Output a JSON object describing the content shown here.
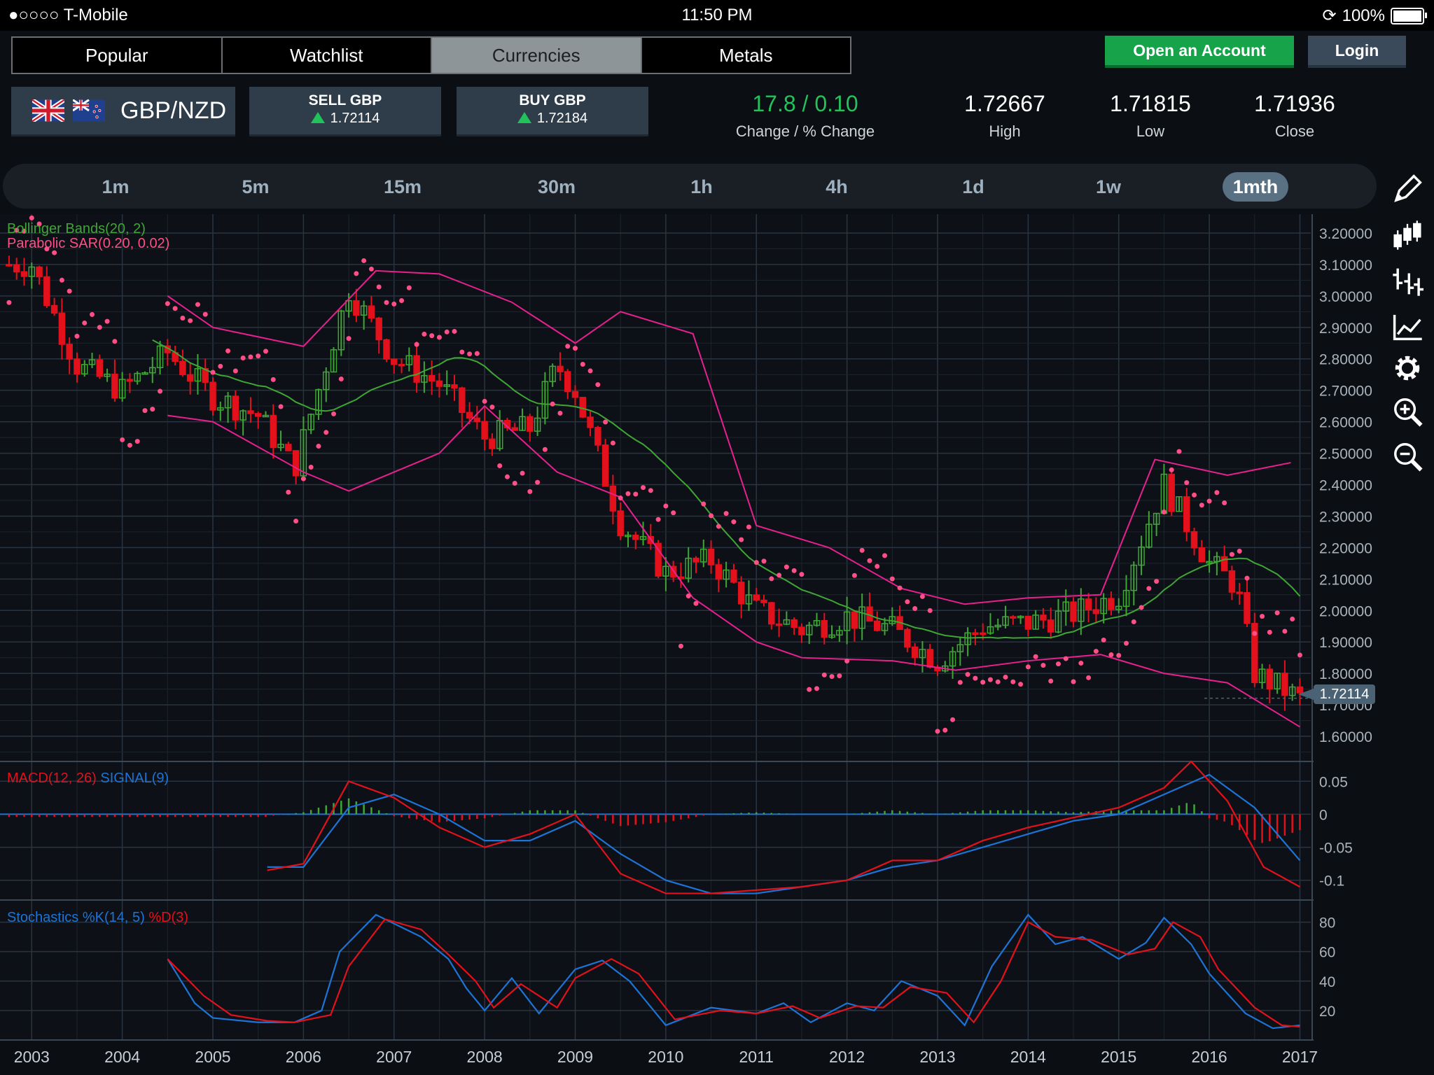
{
  "status_bar": {
    "carrier": "●○○○○ T-Mobile",
    "time": "11:50 PM",
    "battery": "100%",
    "battery_level": 1.0
  },
  "nav_tabs": [
    {
      "label": "Popular",
      "active": false
    },
    {
      "label": "Watchlist",
      "active": false
    },
    {
      "label": "Currencies",
      "active": true
    },
    {
      "label": "Metals",
      "active": false
    }
  ],
  "header_buttons": {
    "open_account": "Open an Account",
    "login": "Login"
  },
  "instrument": {
    "pair": "GBP/NZD",
    "sell_label": "SELL GBP",
    "sell_price": "1.72114",
    "buy_label": "BUY GBP",
    "buy_price": "1.72184",
    "change_value": "17.8 / 0.10",
    "change_label": "Change / % Change",
    "high_value": "1.72667",
    "high_label": "High",
    "low_value": "1.71815",
    "low_label": "Low",
    "close_value": "1.71936",
    "close_label": "Close"
  },
  "timeframes": [
    {
      "label": "1m",
      "active": false
    },
    {
      "label": "5m",
      "active": false
    },
    {
      "label": "15m",
      "active": false
    },
    {
      "label": "30m",
      "active": false
    },
    {
      "label": "1h",
      "active": false
    },
    {
      "label": "4h",
      "active": false
    },
    {
      "label": "1d",
      "active": false
    },
    {
      "label": "1w",
      "active": false
    },
    {
      "label": "1mth",
      "active": true
    }
  ],
  "toolbar_icons": [
    "pencil-icon",
    "candlestick-icon",
    "ohlc-bars-icon",
    "line-chart-icon",
    "gear-icon",
    "zoom-in-icon",
    "zoom-out-icon"
  ],
  "colors": {
    "bull": "#3fa535",
    "bear": "#e3111b",
    "sar": "#ff4f86",
    "bollinger_mid": "#3fa535",
    "bollinger_band": "#e8208f",
    "macd": "#e3111b",
    "signal": "#1d74d6",
    "stoch_k": "#1d74d6",
    "stoch_d": "#e3111b"
  },
  "current_price_tag": "1.72114",
  "chart_data": [
    {
      "type": "candlestick",
      "indicators_legend": [
        "Bollinger Bands(20, 2)",
        "Parabolic SAR(0.20, 0.02)"
      ],
      "y_ticks": [
        "3.20000",
        "3.10000",
        "3.00000",
        "2.90000",
        "2.80000",
        "2.70000",
        "2.60000",
        "2.50000",
        "2.40000",
        "2.30000",
        "2.20000",
        "2.10000",
        "2.00000",
        "1.90000",
        "1.80000",
        "1.70000",
        "1.60000"
      ],
      "ylim": [
        1.52,
        3.26
      ],
      "x_ticks": [
        "2003",
        "2004",
        "2005",
        "2006",
        "2007",
        "2008",
        "2009",
        "2010",
        "2011",
        "2012",
        "2013",
        "2014",
        "2015",
        "2016",
        "2017"
      ],
      "xlim": [
        2002.65,
        2017.12
      ],
      "series": [
        {
          "name": "Price (monthly close)",
          "x": [
            2003.0,
            2003.5,
            2004.0,
            2004.5,
            2005.0,
            2005.5,
            2005.9,
            2006.5,
            2007.0,
            2007.5,
            2008.0,
            2008.5,
            2008.8,
            2009.0,
            2009.5,
            2010.0,
            2010.5,
            2011.0,
            2011.5,
            2012.0,
            2012.5,
            2013.0,
            2013.5,
            2014.0,
            2014.5,
            2015.0,
            2015.5,
            2015.8,
            2016.0,
            2016.3,
            2016.5,
            2017.0
          ],
          "values": [
            3.1,
            2.78,
            2.7,
            2.82,
            2.68,
            2.62,
            2.45,
            3.02,
            2.8,
            2.72,
            2.55,
            2.58,
            2.78,
            2.7,
            2.28,
            2.12,
            2.16,
            2.0,
            1.94,
            1.98,
            1.94,
            1.84,
            1.95,
            1.96,
            1.99,
            2.05,
            2.4,
            2.25,
            2.15,
            2.08,
            1.8,
            1.72
          ]
        },
        {
          "name": "Bollinger upper",
          "x": [
            2004.5,
            2005.0,
            2006.0,
            2006.8,
            2007.5,
            2008.3,
            2009.0,
            2009.5,
            2010.3,
            2011.0,
            2011.8,
            2012.6,
            2013.3,
            2014.0,
            2014.8,
            2015.4,
            2016.2,
            2016.9
          ],
          "values": [
            3.0,
            2.9,
            2.84,
            3.08,
            3.07,
            2.98,
            2.85,
            2.95,
            2.88,
            2.27,
            2.2,
            2.07,
            2.02,
            2.04,
            2.05,
            2.48,
            2.43,
            2.47
          ]
        },
        {
          "name": "Bollinger lower",
          "x": [
            2004.5,
            2005.0,
            2006.0,
            2006.5,
            2007.5,
            2008.0,
            2008.8,
            2009.5,
            2010.3,
            2011.0,
            2011.5,
            2012.5,
            2013.2,
            2014.0,
            2014.8,
            2015.5,
            2016.2,
            2017.0
          ],
          "values": [
            2.62,
            2.6,
            2.44,
            2.38,
            2.5,
            2.65,
            2.44,
            2.36,
            2.04,
            1.9,
            1.85,
            1.84,
            1.81,
            1.84,
            1.86,
            1.8,
            1.77,
            1.63
          ]
        }
      ]
    },
    {
      "type": "line",
      "legend": [
        "MACD(12, 26)",
        "SIGNAL(9)"
      ],
      "y_ticks": [
        "0.05",
        "0",
        "-0.05",
        "-0.1"
      ],
      "ylim": [
        -0.13,
        0.08
      ],
      "series": [
        {
          "name": "MACD(12, 26)",
          "x": [
            2005.6,
            2006.0,
            2006.5,
            2007.0,
            2007.5,
            2008.0,
            2008.5,
            2009.0,
            2009.5,
            2010.0,
            2010.5,
            2011.0,
            2011.5,
            2012.0,
            2012.5,
            2013.0,
            2013.5,
            2014.0,
            2014.5,
            2015.0,
            2015.5,
            2015.8,
            2016.2,
            2016.6,
            2017.0
          ],
          "values": [
            -0.085,
            -0.075,
            0.05,
            0.025,
            -0.02,
            -0.05,
            -0.03,
            0.0,
            -0.09,
            -0.12,
            -0.12,
            -0.115,
            -0.11,
            -0.1,
            -0.07,
            -0.07,
            -0.04,
            -0.02,
            -0.005,
            0.01,
            0.04,
            0.08,
            0.02,
            -0.08,
            -0.11
          ]
        },
        {
          "name": "SIGNAL(9)",
          "x": [
            2005.6,
            2006.0,
            2006.5,
            2007.0,
            2007.5,
            2008.0,
            2008.5,
            2009.0,
            2009.5,
            2010.0,
            2010.5,
            2011.0,
            2011.5,
            2012.0,
            2012.5,
            2013.0,
            2013.5,
            2014.0,
            2014.5,
            2015.0,
            2015.5,
            2016.0,
            2016.5,
            2017.0
          ],
          "values": [
            -0.08,
            -0.08,
            0.01,
            0.03,
            0.0,
            -0.04,
            -0.04,
            -0.01,
            -0.06,
            -0.1,
            -0.12,
            -0.12,
            -0.11,
            -0.1,
            -0.08,
            -0.07,
            -0.05,
            -0.03,
            -0.01,
            0.0,
            0.03,
            0.06,
            0.01,
            -0.07
          ]
        }
      ]
    },
    {
      "type": "line",
      "legend": [
        "Stochastics %K(14, 5)",
        "%D(3)"
      ],
      "y_ticks": [
        "80",
        "60",
        "40",
        "20"
      ],
      "ylim": [
        0,
        95
      ],
      "series": [
        {
          "name": "Stochastics %K(14, 5)",
          "x": [
            2004.5,
            2004.8,
            2005.0,
            2005.5,
            2005.9,
            2006.2,
            2006.4,
            2006.8,
            2007.3,
            2007.6,
            2007.8,
            2008.0,
            2008.3,
            2008.6,
            2009.0,
            2009.3,
            2009.6,
            2010.0,
            2010.5,
            2011.0,
            2011.3,
            2011.6,
            2012.0,
            2012.3,
            2012.6,
            2013.0,
            2013.3,
            2013.6,
            2014.0,
            2014.3,
            2014.6,
            2015.0,
            2015.3,
            2015.5,
            2015.8,
            2016.0,
            2016.4,
            2016.7,
            2017.0
          ],
          "values": [
            55,
            25,
            15,
            12,
            12,
            20,
            60,
            85,
            70,
            55,
            35,
            20,
            42,
            18,
            48,
            54,
            40,
            10,
            22,
            18,
            25,
            12,
            25,
            20,
            40,
            30,
            10,
            50,
            85,
            65,
            70,
            55,
            66,
            83,
            65,
            45,
            18,
            8,
            10
          ]
        },
        {
          "name": "%D(3)",
          "x": [
            2004.5,
            2004.9,
            2005.2,
            2005.6,
            2005.9,
            2006.3,
            2006.5,
            2006.9,
            2007.3,
            2007.6,
            2007.9,
            2008.1,
            2008.4,
            2008.8,
            2009.0,
            2009.4,
            2009.7,
            2010.1,
            2010.6,
            2011.0,
            2011.4,
            2011.7,
            2012.1,
            2012.4,
            2012.7,
            2013.1,
            2013.4,
            2013.7,
            2014.0,
            2014.3,
            2014.7,
            2015.1,
            2015.4,
            2015.6,
            2015.9,
            2016.1,
            2016.5,
            2016.8,
            2017.0
          ],
          "values": [
            55,
            30,
            17,
            13,
            12,
            17,
            50,
            82,
            75,
            58,
            40,
            22,
            38,
            22,
            42,
            55,
            45,
            14,
            20,
            18,
            23,
            15,
            23,
            22,
            36,
            32,
            12,
            40,
            80,
            70,
            68,
            58,
            62,
            80,
            70,
            48,
            22,
            10,
            9
          ]
        }
      ]
    }
  ]
}
